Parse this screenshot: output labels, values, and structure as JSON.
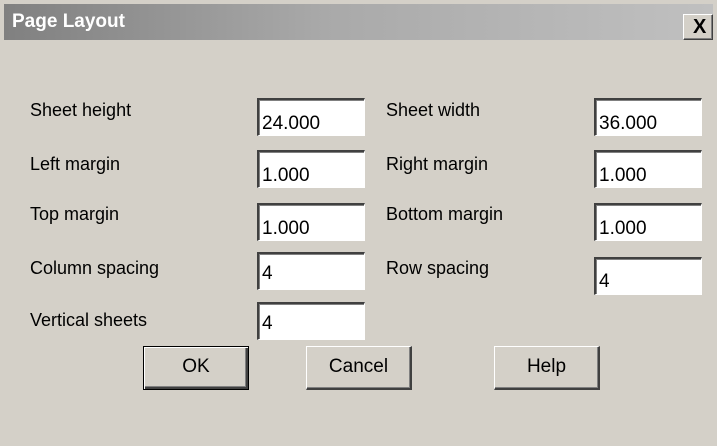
{
  "dialog": {
    "title": "Page Layout",
    "close_glyph": "X",
    "close_icon": "close-icon"
  },
  "fields": {
    "sheet_height": {
      "label": "Sheet height",
      "value": "24.000"
    },
    "sheet_width": {
      "label": "Sheet width",
      "value": "36.000"
    },
    "left_margin": {
      "label": "Left margin",
      "value": "1.000"
    },
    "right_margin": {
      "label": "Right margin",
      "value": "1.000"
    },
    "top_margin": {
      "label": "Top margin",
      "value": "1.000"
    },
    "bottom_margin": {
      "label": "Bottom margin",
      "value": "1.000"
    },
    "column_spacing": {
      "label": "Column spacing",
      "value": "4"
    },
    "row_spacing": {
      "label": "Row spacing",
      "value": "4"
    },
    "vertical_sheets": {
      "label": "Vertical sheets",
      "value": "4"
    }
  },
  "buttons": {
    "ok": "OK",
    "cancel": "Cancel",
    "help": "Help"
  },
  "colors": {
    "dialog_bg": "#d4d0c8",
    "title_text": "#ffffff",
    "field_bg": "#ffffff"
  }
}
